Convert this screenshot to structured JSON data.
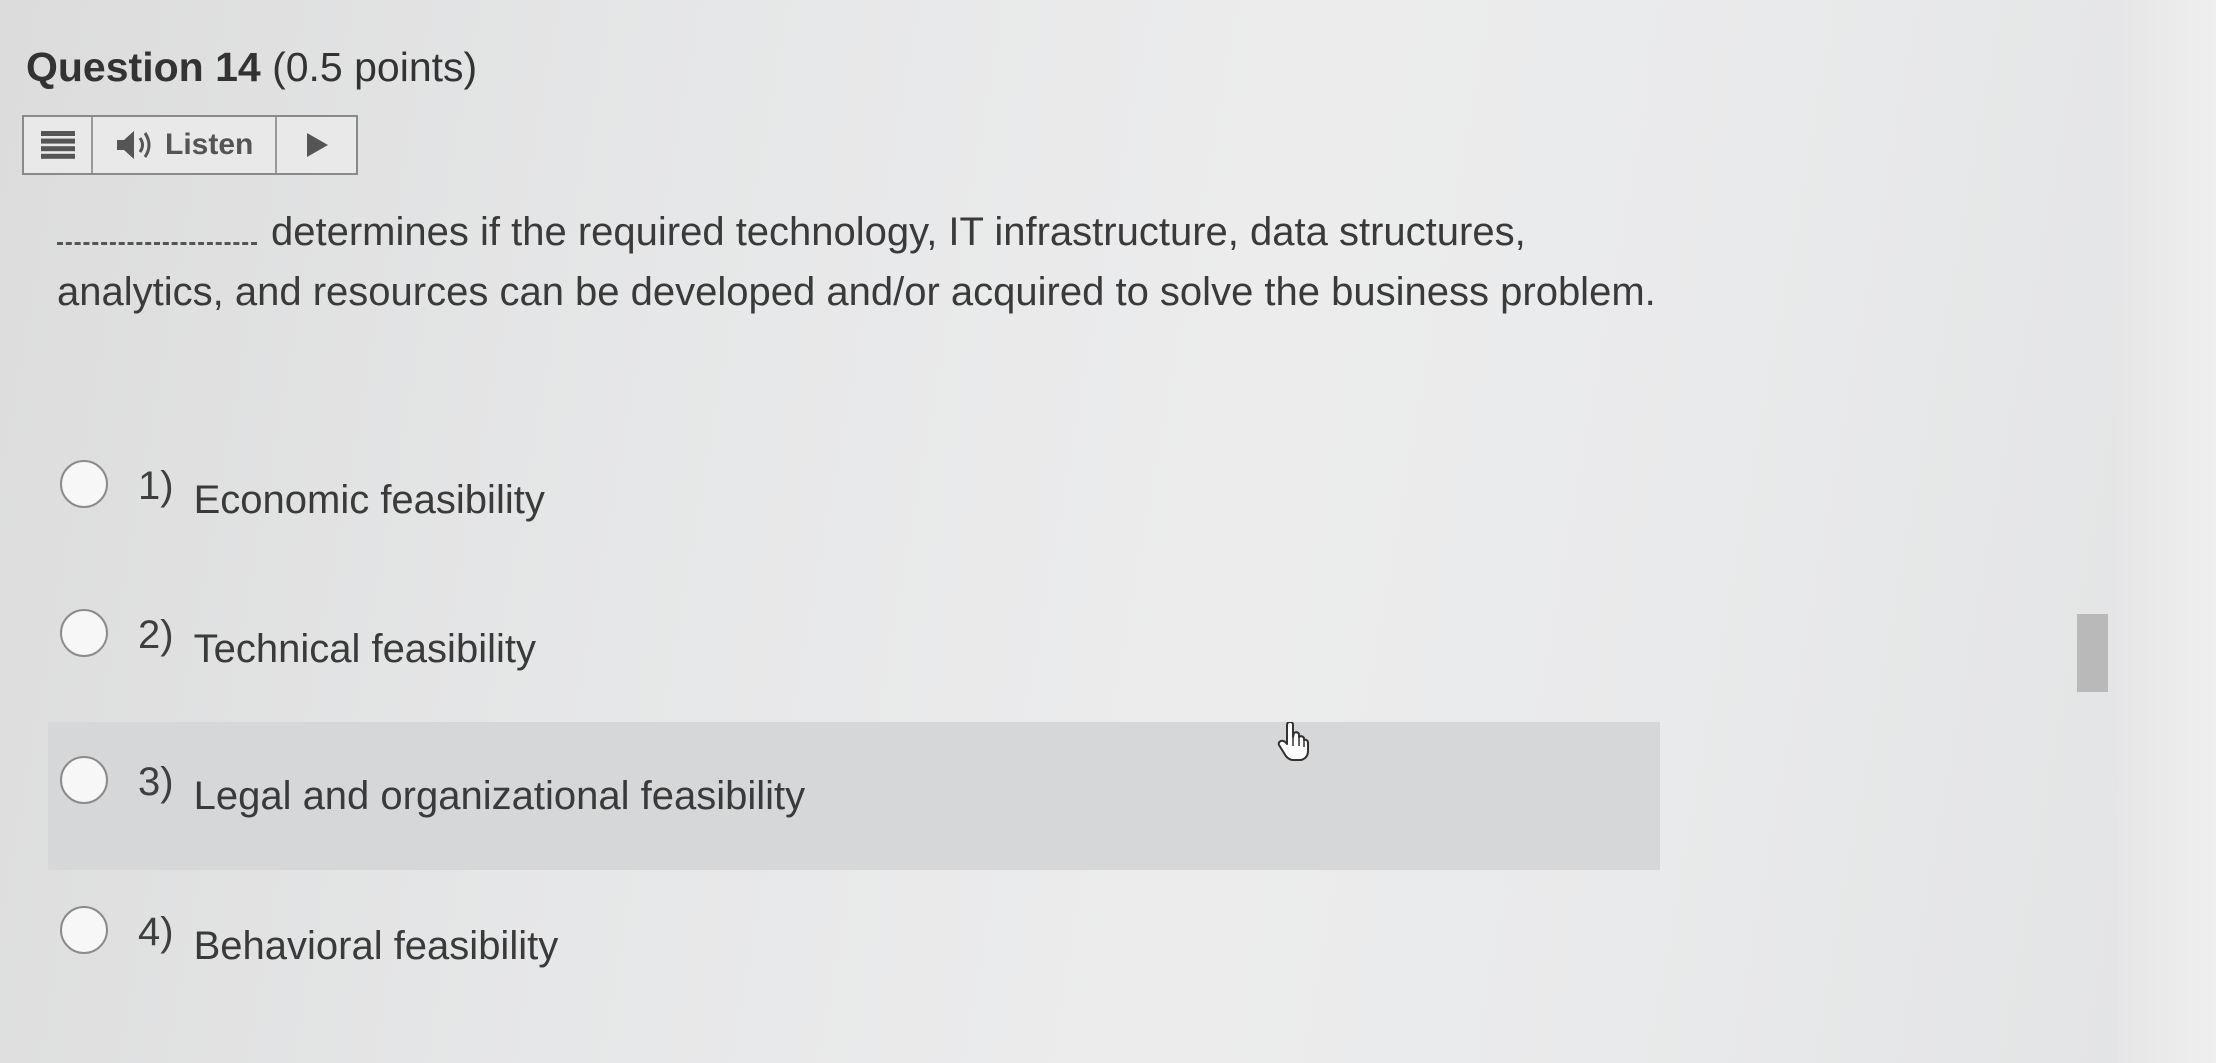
{
  "question": {
    "number_label": "Question 14",
    "points_label": "(0.5 points)"
  },
  "listen": {
    "label": "Listen",
    "menu_icon": "menu-icon",
    "speaker_icon": "speaker-icon",
    "play_icon": "play-icon"
  },
  "prompt": {
    "text": "determines if the required technology, IT infrastructure, data structures, analytics, and resources can be developed and/or acquired to solve the business problem."
  },
  "options": [
    {
      "num": "1)",
      "text": "Economic feasibility"
    },
    {
      "num": "2)",
      "text": "Technical feasibility"
    },
    {
      "num": "3)",
      "text": "Legal and organizational feasibility"
    },
    {
      "num": "4)",
      "text": "Behavioral feasibility"
    }
  ],
  "cursor_icon": "hand-pointer-icon",
  "colors": {
    "hover_row": "#d6d7d8",
    "scroll_thumb": "#b9b9b9"
  }
}
